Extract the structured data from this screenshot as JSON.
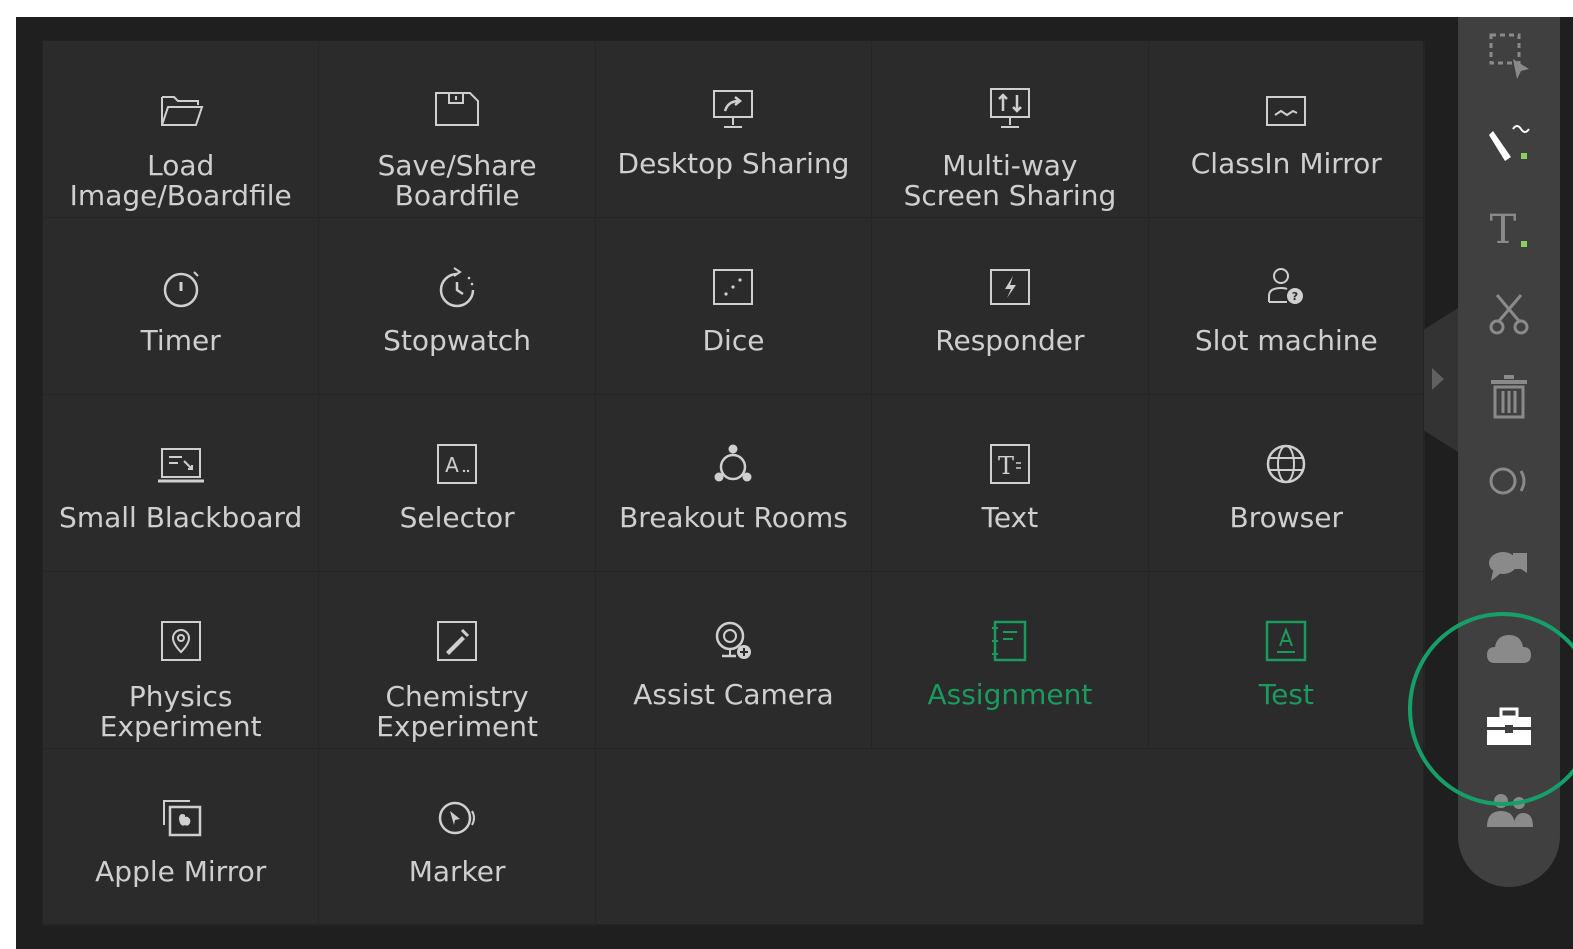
{
  "tools": [
    {
      "id": "load",
      "label": "Load\nImage/Boardfile",
      "icon": "folder-icon",
      "state": "normal"
    },
    {
      "id": "save",
      "label": "Save/Share\nBoardfile",
      "icon": "floppy-disk-icon",
      "state": "normal"
    },
    {
      "id": "desktop",
      "label": "Desktop Sharing",
      "icon": "monitor-share-icon",
      "state": "normal"
    },
    {
      "id": "multiway",
      "label": "Multi-way\nScreen Sharing",
      "icon": "monitor-multi-share-icon",
      "state": "normal"
    },
    {
      "id": "mirror",
      "label": "ClassIn Mirror",
      "icon": "mirror-icon",
      "state": "normal"
    },
    {
      "id": "timer",
      "label": "Timer",
      "icon": "timer-icon",
      "state": "normal"
    },
    {
      "id": "stopwatch",
      "label": "Stopwatch",
      "icon": "stopwatch-icon",
      "state": "normal"
    },
    {
      "id": "dice",
      "label": "Dice",
      "icon": "dice-icon",
      "state": "normal"
    },
    {
      "id": "responder",
      "label": "Responder",
      "icon": "lightning-icon",
      "state": "normal"
    },
    {
      "id": "slot",
      "label": "Slot machine",
      "icon": "person-question-icon",
      "state": "normal"
    },
    {
      "id": "blackboard",
      "label": "Small Blackboard",
      "icon": "blackboard-icon",
      "state": "normal"
    },
    {
      "id": "selector",
      "label": "Selector",
      "icon": "selector-icon",
      "state": "normal"
    },
    {
      "id": "breakout",
      "label": "Breakout Rooms",
      "icon": "breakout-icon",
      "state": "normal"
    },
    {
      "id": "text",
      "label": "Text",
      "icon": "text-box-icon",
      "state": "normal"
    },
    {
      "id": "browser",
      "label": "Browser",
      "icon": "globe-icon",
      "state": "normal"
    },
    {
      "id": "physics",
      "label": "Physics\nExperiment",
      "icon": "physics-icon",
      "state": "normal"
    },
    {
      "id": "chemistry",
      "label": "Chemistry\nExperiment",
      "icon": "chemistry-icon",
      "state": "normal"
    },
    {
      "id": "camera",
      "label": "Assist Camera",
      "icon": "camera-add-icon",
      "state": "normal"
    },
    {
      "id": "assignment",
      "label": "Assignment",
      "icon": "notebook-icon",
      "state": "green"
    },
    {
      "id": "test",
      "label": "Test",
      "icon": "test-icon",
      "state": "green"
    },
    {
      "id": "apple",
      "label": "Apple Mirror",
      "icon": "apple-mirror-icon",
      "state": "normal"
    },
    {
      "id": "marker",
      "label": "Marker",
      "icon": "marker-icon",
      "state": "normal"
    }
  ],
  "colors": {
    "panel_bg": "#2b2b2b",
    "toolbar_bg": "#404040",
    "green_accent": "#1a9a5c",
    "highlight_ring": "#169f69"
  },
  "toolbar": [
    {
      "icon": "selection-icon",
      "active": false
    },
    {
      "icon": "pen-icon",
      "active": true
    },
    {
      "icon": "text-icon",
      "active": false
    },
    {
      "icon": "scissors-icon",
      "active": false
    },
    {
      "icon": "trash-icon",
      "active": false
    },
    {
      "icon": "laser-icon",
      "active": false
    },
    {
      "icon": "chat-icon",
      "active": false
    },
    {
      "icon": "cloud-icon",
      "active": false
    },
    {
      "icon": "toolbox-icon",
      "active": true
    },
    {
      "icon": "people-icon",
      "active": false
    }
  ]
}
